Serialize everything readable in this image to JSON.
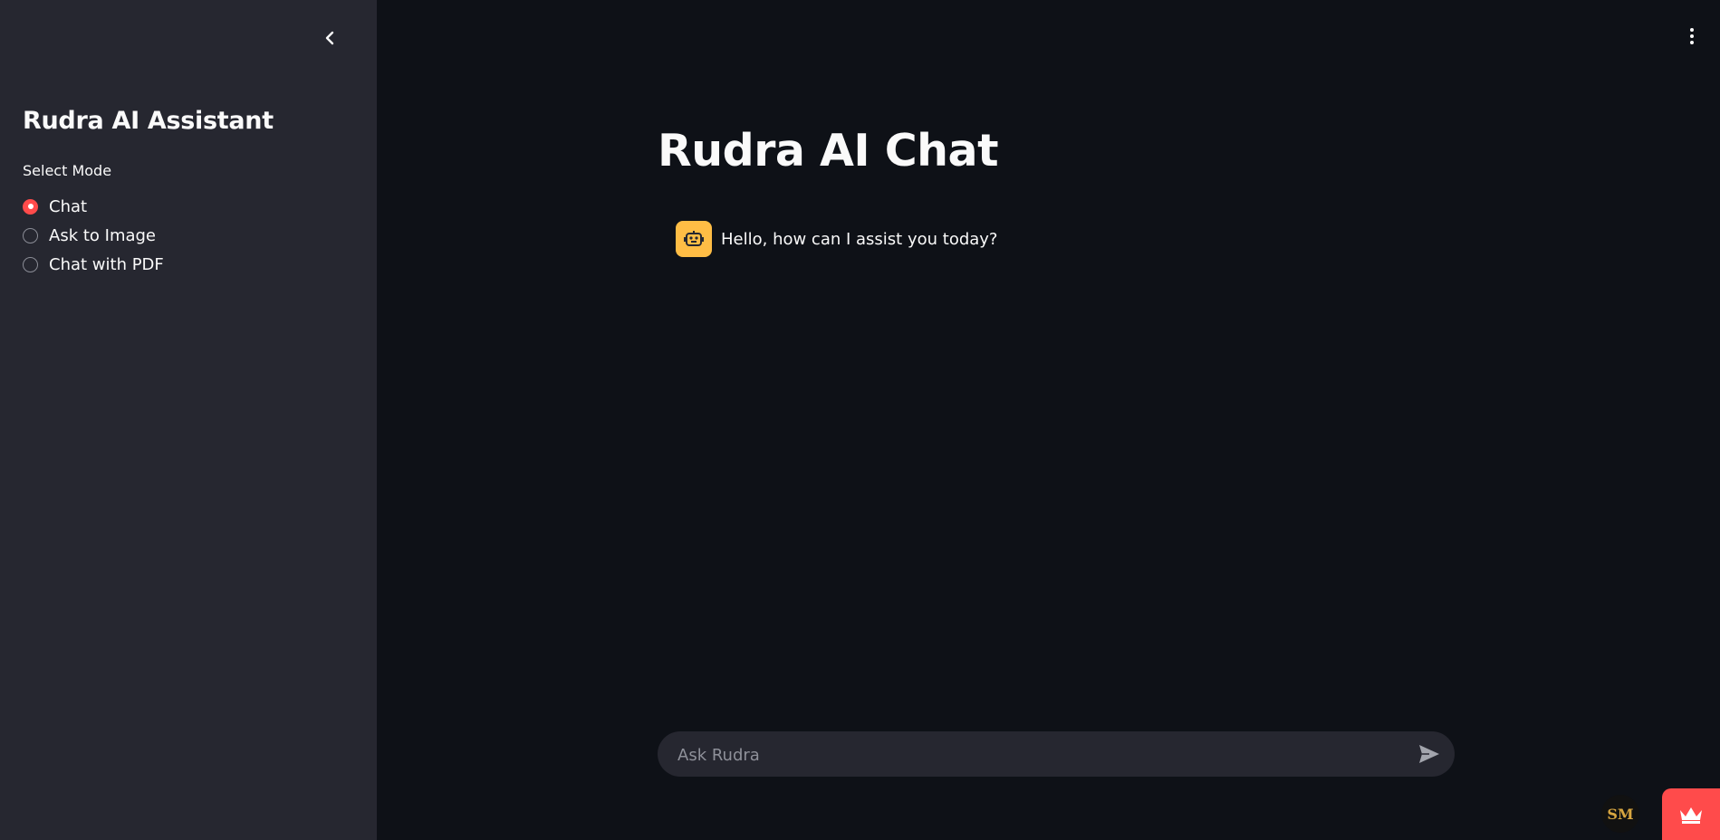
{
  "sidebar": {
    "title": "Rudra AI Assistant",
    "mode_label": "Select Mode",
    "modes": [
      {
        "label": "Chat",
        "selected": true
      },
      {
        "label": "Ask to Image",
        "selected": false
      },
      {
        "label": "Chat with PDF",
        "selected": false
      }
    ]
  },
  "main": {
    "title": "Rudra AI Chat",
    "messages": [
      {
        "role": "assistant",
        "avatar_icon": "robot-icon",
        "text": "Hello, how can I assist you today?"
      }
    ],
    "input": {
      "placeholder": "Ask Rudra",
      "value": ""
    }
  },
  "badge": {
    "text": "SM"
  },
  "icons": {
    "collapse": "chevron-left-icon",
    "menu": "vertical-dots-icon",
    "send": "send-icon",
    "deploy": "crown-icon"
  },
  "colors": {
    "main_bg": "#0e1117",
    "sidebar_bg": "#262730",
    "accent": "#ff4b4b",
    "avatar_bg": "#ffbd45",
    "badge_text": "#d8a640"
  }
}
